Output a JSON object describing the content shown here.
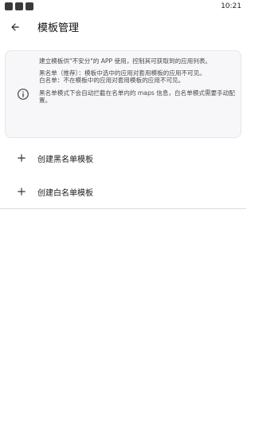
{
  "status_bar": {
    "time": "10:21"
  },
  "app_bar": {
    "title": "模板管理",
    "back_icon": "arrow-left-icon"
  },
  "info_card": {
    "icon": "info-icon",
    "paragraphs": [
      "建立模板供\"不安分\"的 APP 使用，控制其可获取到的应用列表。",
      "黑名单（推荐）：模板中选中的应用对套用模板的应用不可见。",
      "白名单：不在模板中的应用对套用模板的应用不可见。",
      "黑名单模式下会自动拦截在名单内的 maps 信息，白名单模式需要手动配置。"
    ]
  },
  "actions": [
    {
      "label": "创建黑名单模板",
      "icon": "plus-icon"
    },
    {
      "label": "创建白名单模板",
      "icon": "plus-icon"
    }
  ]
}
